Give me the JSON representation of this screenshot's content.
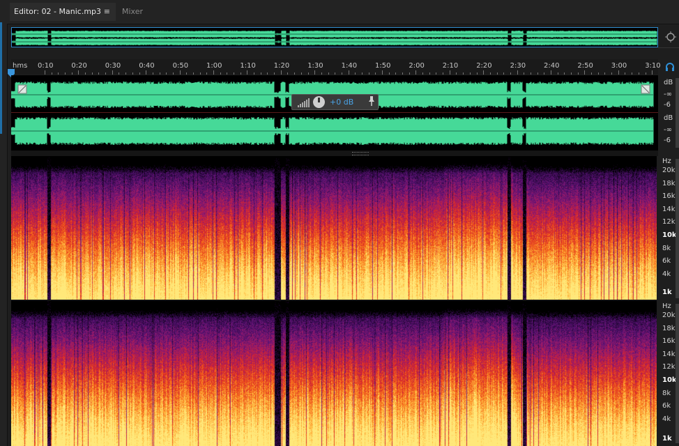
{
  "tabs": {
    "editor_label": "Editor: 02 - Manic.mp3",
    "editor_menu_icon": "≡",
    "mixer_label": "Mixer"
  },
  "ruler": {
    "unit_label": "hms",
    "ticks": [
      "0:10",
      "0:20",
      "0:30",
      "0:40",
      "0:50",
      "1:00",
      "1:10",
      "1:20",
      "1:30",
      "1:40",
      "1:50",
      "2:00",
      "2:10",
      "2:20",
      "2:30",
      "2:40",
      "2:50",
      "3:00",
      "3:10"
    ]
  },
  "waveform": {
    "color": "#46d998",
    "channels": [
      {
        "db_unit": "dB",
        "db_ticks": [
          "-∞",
          "-6"
        ]
      },
      {
        "db_unit": "dB",
        "db_ticks": [
          "-∞",
          "-6"
        ]
      }
    ]
  },
  "hud": {
    "level_label": "+0 dB"
  },
  "spectral": {
    "unit_label": "Hz",
    "ticks": [
      "20k",
      "18k",
      "16k",
      "14k",
      "12k",
      "10k",
      "8k",
      "6k",
      "4k",
      "1k"
    ],
    "bold_ticks": [
      "10k",
      "1k"
    ],
    "colors": [
      "#000000",
      "#2a0840",
      "#5a1275",
      "#9b1a6a",
      "#d8262a",
      "#f4641a",
      "#ffb43a",
      "#ffe87a"
    ]
  },
  "icons": {
    "zoom": "zoom-icon",
    "headphone": "headphone-icon",
    "pin": "pin-icon",
    "meter": "meter-bars-icon",
    "menu": "menu-icon"
  }
}
